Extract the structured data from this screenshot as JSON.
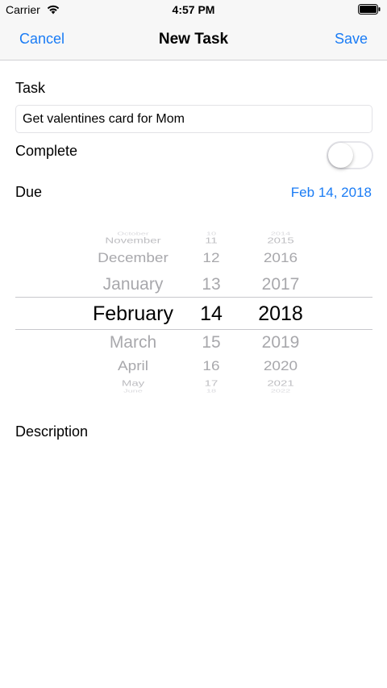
{
  "status_bar": {
    "carrier": "Carrier",
    "time": "4:57 PM",
    "wifi_icon": "wifi-icon",
    "battery_icon": "battery-icon"
  },
  "nav": {
    "cancel": "Cancel",
    "title": "New Task",
    "save": "Save"
  },
  "form": {
    "task_label": "Task",
    "task_value": "Get valentines card for Mom",
    "complete_label": "Complete",
    "complete_on": false,
    "due_label": "Due",
    "due_value": "Feb 14, 2018",
    "description_label": "Description"
  },
  "picker": {
    "months": [
      "November",
      "December",
      "January",
      "February",
      "March",
      "April",
      "May"
    ],
    "days": [
      "11",
      "12",
      "13",
      "14",
      "15",
      "16",
      "17"
    ],
    "years": [
      "2015",
      "2016",
      "2017",
      "2018",
      "2019",
      "2020",
      "2021"
    ],
    "selected": {
      "month": "February",
      "day": "14",
      "year": "2018"
    }
  },
  "colors": {
    "accent": "#1a7cf5",
    "bar_background": "#f7f7f7"
  }
}
